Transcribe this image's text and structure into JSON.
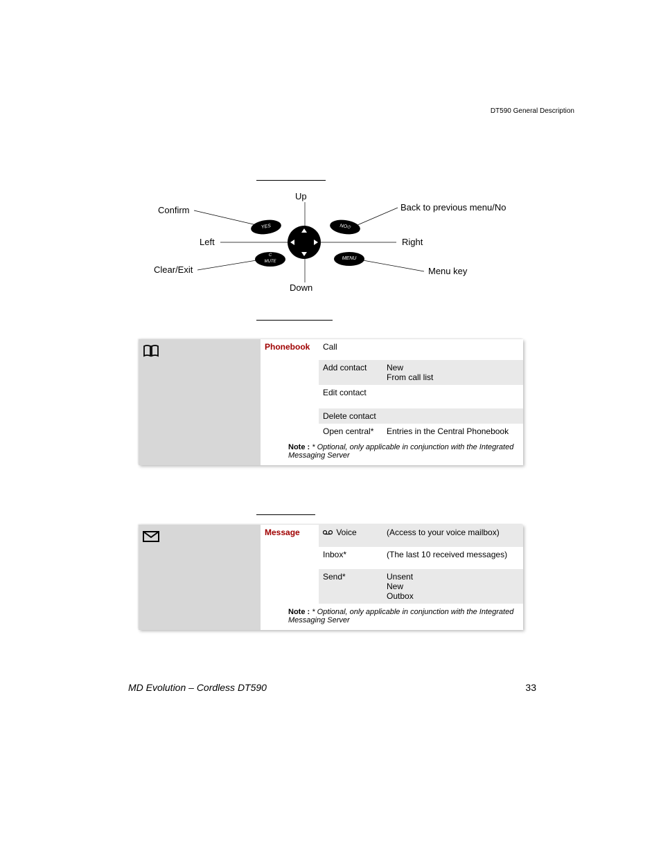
{
  "header": {
    "right": "DT590 General Description"
  },
  "footer": {
    "left": "MD Evolution – Cordless DT590",
    "page": "33"
  },
  "diagram": {
    "labels": {
      "up": "Up",
      "down": "Down",
      "left": "Left",
      "right": "Right",
      "confirm": "Confirm",
      "back": "Back to previous menu/No",
      "clear": "Clear/Exit",
      "menu": "Menu key"
    },
    "buttons": {
      "yes": "YES",
      "no": "NO",
      "mute": "C\nMUTE",
      "menu": "MENU"
    }
  },
  "phonebook": {
    "heading": "Phonebook",
    "rows": [
      {
        "sub": "Call",
        "opt": ""
      },
      {
        "sub": "Add contact",
        "opt": "New\nFrom call list"
      },
      {
        "sub": "Edit contact",
        "opt": ""
      },
      {
        "sub": "Delete contact",
        "opt": ""
      },
      {
        "sub": "Open central*",
        "opt": "Entries in the Central Phonebook"
      }
    ],
    "note_label": "Note :",
    "note_text": "* Optional, only applicable in conjunction with the Integrated Messaging Server"
  },
  "message": {
    "heading": "Message",
    "rows": [
      {
        "sub": "Voice",
        "opt": "(Access to your voice mailbox)",
        "icon": true
      },
      {
        "sub": "Inbox*",
        "opt": "(The last 10 received messages)"
      },
      {
        "sub": "Send*",
        "opt": "Unsent\nNew\nOutbox"
      }
    ],
    "note_label": "Note :",
    "note_text": "* Optional, only applicable in conjunction with the Integrated Messaging Server"
  }
}
